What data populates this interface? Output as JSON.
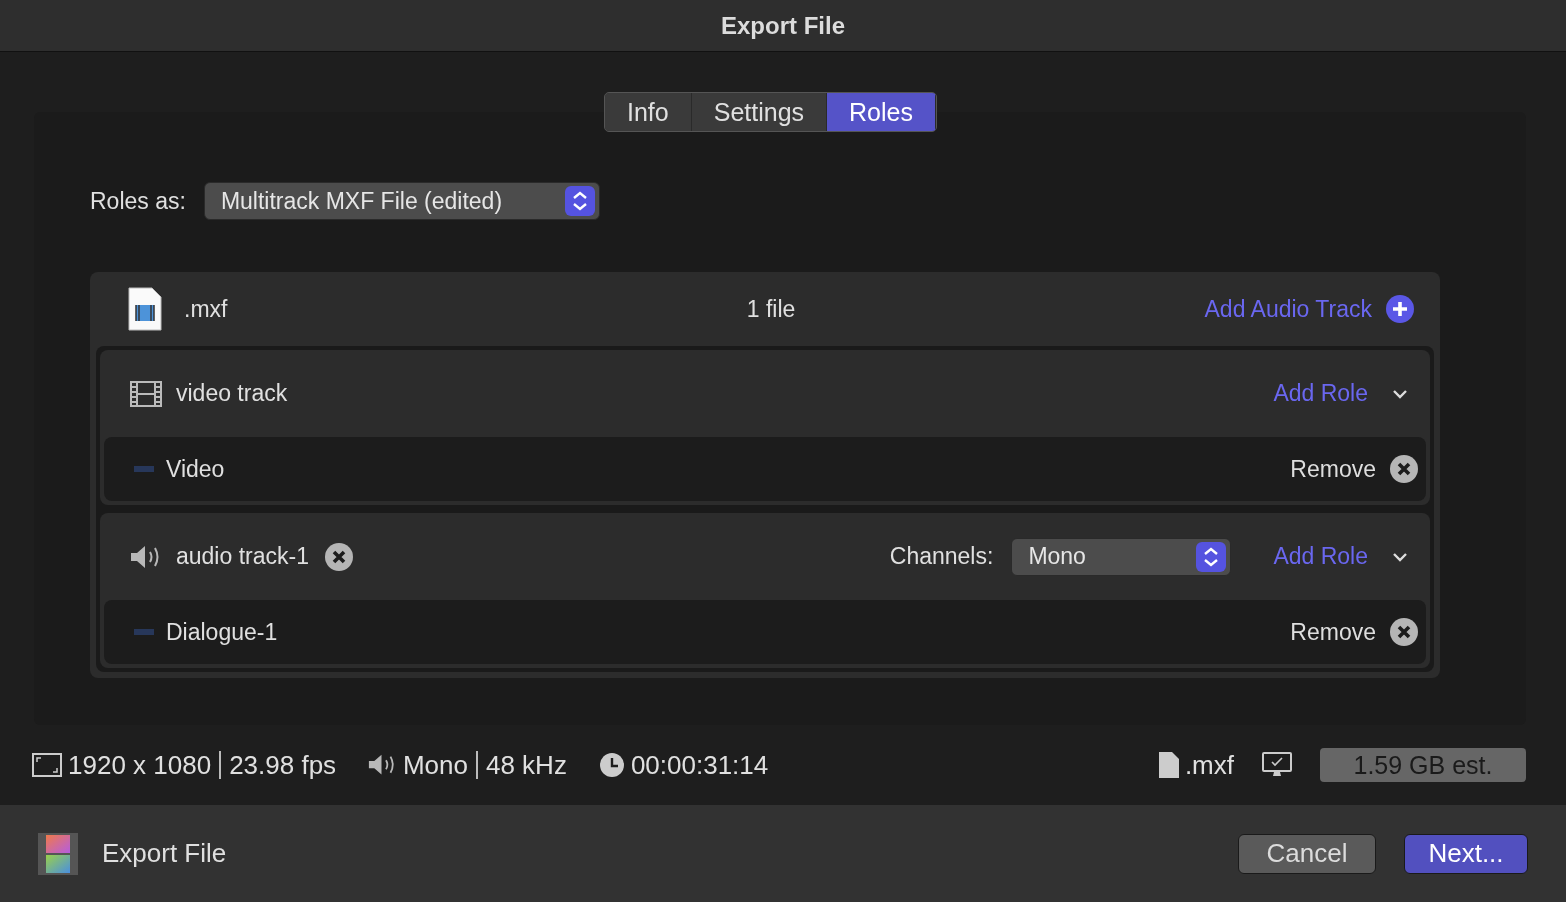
{
  "window": {
    "title": "Export File"
  },
  "tabs": [
    {
      "label": "Info",
      "selected": false
    },
    {
      "label": "Settings",
      "selected": false
    },
    {
      "label": "Roles",
      "selected": true
    }
  ],
  "roles_as": {
    "label": "Roles as:",
    "value": "Multitrack MXF File (edited)"
  },
  "file": {
    "name": ".mxf",
    "count": "1 file",
    "add_label": "Add Audio Track"
  },
  "tracks": [
    {
      "kind": "video",
      "name": "video track",
      "removable": false,
      "add_label": "Add Role",
      "roles": [
        {
          "name": "Video",
          "color": "#27375a",
          "action": "Remove"
        }
      ]
    },
    {
      "kind": "audio",
      "name": "audio track-1",
      "removable": true,
      "channels_label": "Channels:",
      "channels": "Mono",
      "add_label": "Add Role",
      "roles": [
        {
          "name": "Dialogue-1",
          "color": "#27375a",
          "action": "Remove"
        }
      ]
    }
  ],
  "summary": {
    "resolution": "1920 x 1080",
    "frame_rate": "23.98 fps",
    "audio_channels": "Mono",
    "sample_rate": "48 kHz",
    "duration": "00:00:31:14",
    "format": ".mxf",
    "size": "1.59 GB est."
  },
  "footer": {
    "title": "Export File",
    "buttons": [
      {
        "label": "Cancel",
        "primary": false
      },
      {
        "label": "Next...",
        "primary": true
      }
    ]
  }
}
